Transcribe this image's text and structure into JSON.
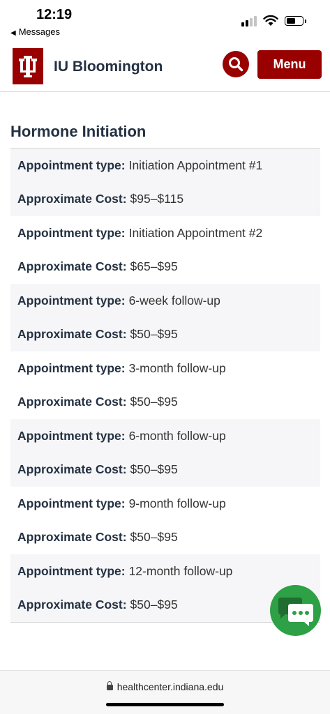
{
  "status_bar": {
    "time": "12:19",
    "back_app": "Messages"
  },
  "header": {
    "site_name": "IU Bloomington",
    "menu_label": "Menu",
    "brand_color": "#990000"
  },
  "section": {
    "title": "Hormone Initiation"
  },
  "labels": {
    "appointment_type": "Appointment type:",
    "approximate_cost": "Approximate Cost:"
  },
  "entries": [
    {
      "type": "Initiation Appointment #1",
      "cost": "$95–$115"
    },
    {
      "type": "Initiation Appointment #2",
      "cost": "$65–$95"
    },
    {
      "type": "6-week follow-up",
      "cost": "$50–$95"
    },
    {
      "type": "3-month follow-up",
      "cost": "$50–$95"
    },
    {
      "type": "6-month follow-up",
      "cost": "$50–$95"
    },
    {
      "type": "9-month follow-up",
      "cost": "$50–$95"
    },
    {
      "type": "12-month follow-up",
      "cost": "$50–$95"
    }
  ],
  "chat": {
    "color": "#2ea045"
  },
  "browser": {
    "url": "healthcenter.indiana.edu"
  }
}
